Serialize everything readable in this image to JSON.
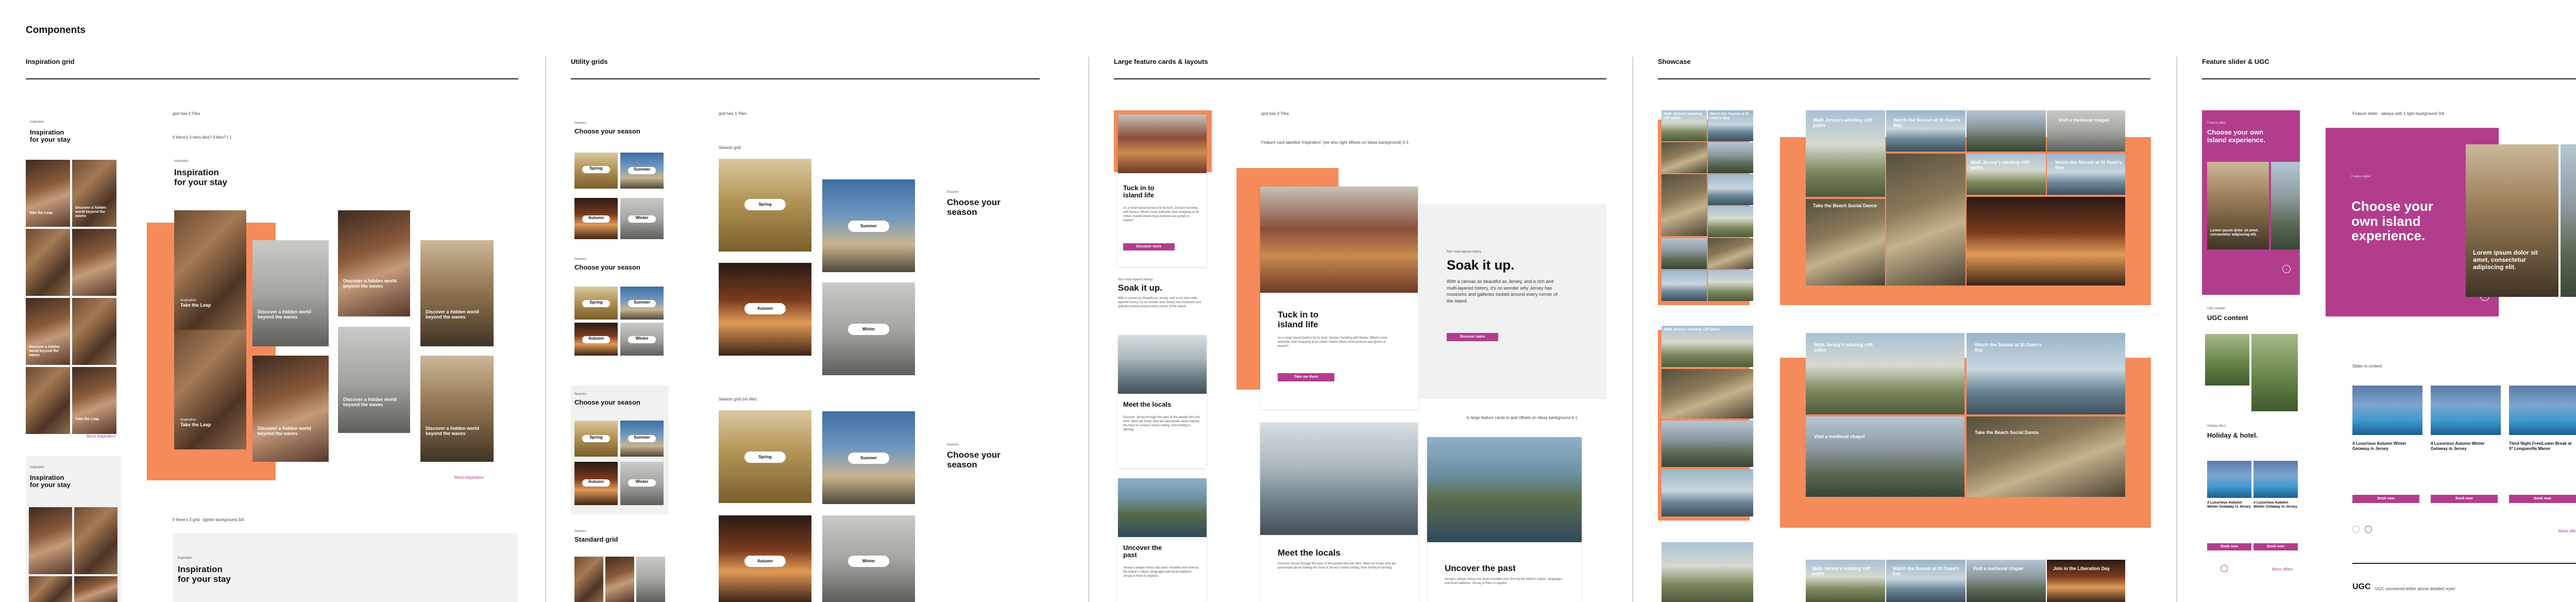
{
  "page": {
    "title": "Components"
  },
  "sections": {
    "inspiration": "Inspiration grid",
    "utility": "Utility grids",
    "large": "Large feature cards & layouts",
    "showcase": "Showcase",
    "slider": "Feature slider & UGC"
  },
  "inspiration": {
    "note1": "grid has 3 Tiles",
    "note2": "if there's 3 hero tiles? 4 tiles? | 1",
    "note3": "if there's 3 grid - lighter background 3/4",
    "eyebrow": "Inspiration",
    "heading_line1": "Inspiration",
    "heading_line2": "for your stay",
    "tile_eyebrow": "Inspiration",
    "tile_take": "Take the Leap",
    "tile_discover": "Discover a hidden world beyond the waves",
    "more_link": "More inspiration"
  },
  "utility": {
    "note1": "grid has 3 Tiles",
    "note2": "Season grid",
    "note3": "Season grid (no title)",
    "eyebrow": "Seasons",
    "heading": "Choose your season",
    "standard": "Standard grid",
    "spring": "Spring",
    "summer": "Summer",
    "autumn": "Autumn",
    "winter": "Winter",
    "side_eyebrow": "Seasons",
    "side_heading_line1": "Choose your",
    "side_heading_line2": "season"
  },
  "large": {
    "note1": "grid has 3 Tiles",
    "note2": "Feature card labelled 'Inspiration' (we also right offsets on Ideas background) 0-1",
    "note3": "Is large feature cards to grid offsets on Ideas background 0-1",
    "tuck_line1": "Tuck in to",
    "tuck_line2": "island life",
    "tuck_body": "As a small island famous for its food, Jersey's bursting with flavour. What's more authentic than shopping at an indoor market where local produce was grown or reared?",
    "take_btn": "Take me there",
    "discover_btn": "Discover more",
    "soak_eyebrow": "Rich multi-layered history",
    "soak_heading": "Soak it up.",
    "soak_body": "With a canvas as beautiful as Jersey, and a rich and multi-layered history, it's no wonder why Jersey has museums and galleries tucked around every corner of the island.",
    "meet": "Meet the locals",
    "meet_body": "Discover Jersey through the eyes of the people who live here. Meet our locals who are passionate about making the most of Jersey's island setting, from fishing to farming.",
    "uncover_line1": "Uncover the",
    "uncover_line2": "past",
    "uncover": "Uncover the past",
    "uncover_body": "Jersey's unique history has been moulded over time by the island's culture, languages and local traditions, Jersey is there to explore."
  },
  "showcase": {
    "walk": "Walk Jersey's winding cliff paths",
    "sunset": "Watch the Sunset at St Ouen's Bay",
    "chapel": "Visit a medieval chapel",
    "dance": "Take the Beach Social Dance",
    "lib": "Join in the Liberation Day"
  },
  "slider": {
    "note1": "Feature slider - always with 1 light background 3/4",
    "eyebrow": "Feature slider",
    "heading_line1": "Choose your own",
    "heading_line2": "island experience.",
    "big_line1": "Choose your",
    "big_line2": "own island",
    "big_line3": "experience.",
    "card_text": "Lorem ipsum dolor sit amet, consectetur adipiscing elit.",
    "ugc_eyebrow": "UGC module",
    "ugc_title": "UGC content",
    "holiday_eyebrow": "Holiday offers",
    "holiday": "Holiday & hotel.",
    "hotel1": "4 Luxurious Autumn Winter Getaway in Jersey",
    "hotel2": "4 Luxurious Autumn Winter Getaway in Jersey",
    "hotel3": "Third Night Free/Lower Break at 5* Longueville Manor",
    "book": "Book now",
    "more_link": "More offers",
    "ugc_label": "UGC",
    "ugc_note": "UGC uncovered tether above detailed 'eyes'",
    "slider_label": "Slider in content"
  }
}
